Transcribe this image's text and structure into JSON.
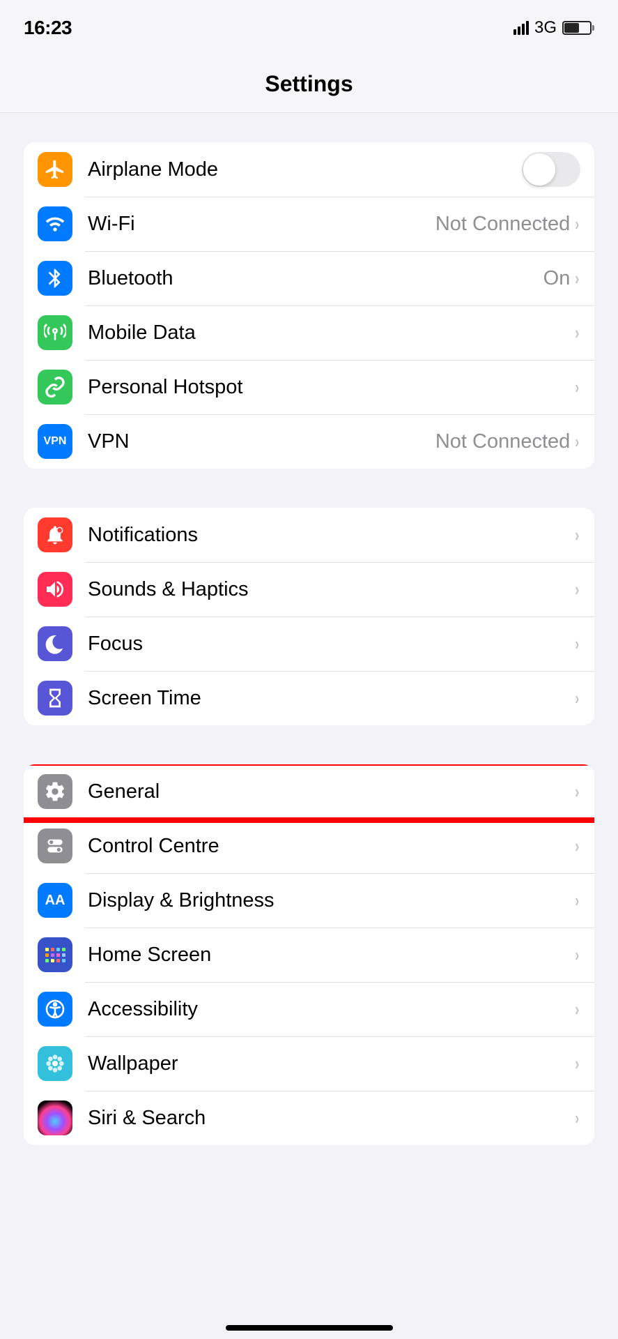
{
  "status": {
    "time": "16:23",
    "network": "3G"
  },
  "header": {
    "title": "Settings"
  },
  "colors": {
    "orange": "#ff9500",
    "blue": "#007aff",
    "green": "#34c759",
    "red": "#ff3b30",
    "pink": "#ff2d55",
    "indigo": "#5856d6",
    "gray": "#8e8e93",
    "teal": "#33c0dd"
  },
  "groups": [
    {
      "id": "network",
      "rows": [
        {
          "id": "airplane",
          "label": "Airplane Mode",
          "iconColor": "#ff9500",
          "type": "toggle",
          "value": false
        },
        {
          "id": "wifi",
          "label": "Wi-Fi",
          "detail": "Not Connected",
          "iconColor": "#007aff",
          "type": "link"
        },
        {
          "id": "bluetooth",
          "label": "Bluetooth",
          "detail": "On",
          "iconColor": "#007aff",
          "type": "link"
        },
        {
          "id": "mobile",
          "label": "Mobile Data",
          "iconColor": "#34c759",
          "type": "link"
        },
        {
          "id": "hotspot",
          "label": "Personal Hotspot",
          "iconColor": "#34c759",
          "type": "link"
        },
        {
          "id": "vpn",
          "label": "VPN",
          "detail": "Not Connected",
          "iconColor": "#007aff",
          "type": "link"
        }
      ]
    },
    {
      "id": "attention",
      "rows": [
        {
          "id": "notifications",
          "label": "Notifications",
          "iconColor": "#ff3b30",
          "type": "link"
        },
        {
          "id": "sounds",
          "label": "Sounds & Haptics",
          "iconColor": "#ff2d55",
          "type": "link"
        },
        {
          "id": "focus",
          "label": "Focus",
          "iconColor": "#5856d6",
          "type": "link"
        },
        {
          "id": "screentime",
          "label": "Screen Time",
          "iconColor": "#5856d6",
          "type": "link"
        }
      ]
    },
    {
      "id": "system",
      "rows": [
        {
          "id": "general",
          "label": "General",
          "iconColor": "#8e8e93",
          "type": "link",
          "highlighted": true
        },
        {
          "id": "control",
          "label": "Control Centre",
          "iconColor": "#8e8e93",
          "type": "link"
        },
        {
          "id": "display",
          "label": "Display & Brightness",
          "iconColor": "#007aff",
          "type": "link"
        },
        {
          "id": "home",
          "label": "Home Screen",
          "iconColor": "#3751c8",
          "type": "link"
        },
        {
          "id": "accessibility",
          "label": "Accessibility",
          "iconColor": "#007aff",
          "type": "link"
        },
        {
          "id": "wallpaper",
          "label": "Wallpaper",
          "iconColor": "#33c0dd",
          "type": "link"
        },
        {
          "id": "siri",
          "label": "Siri & Search",
          "iconColor": "siri",
          "type": "link"
        }
      ]
    }
  ]
}
